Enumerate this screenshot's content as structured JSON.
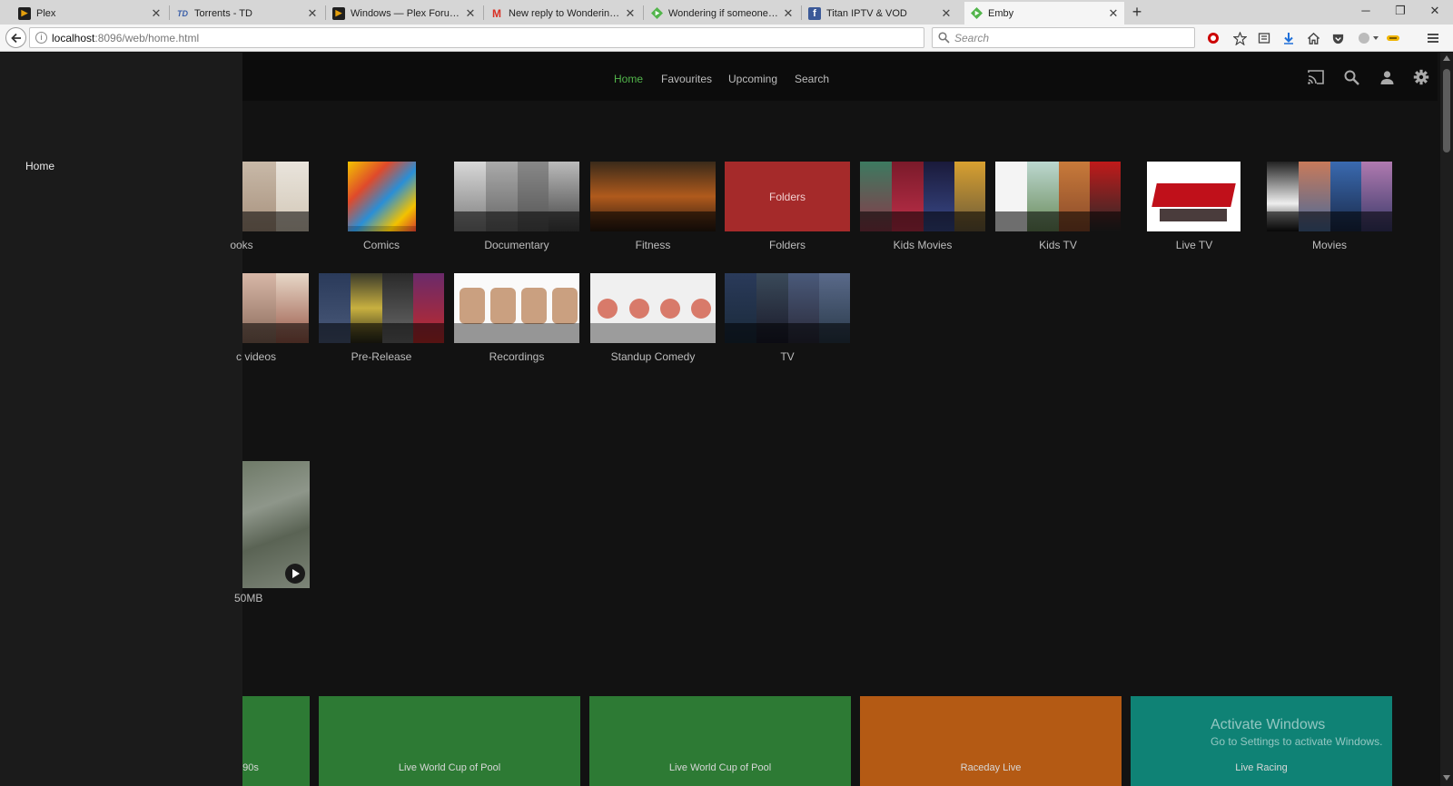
{
  "browser": {
    "tabs": [
      {
        "label": "Plex",
        "favicon": "plex-icon",
        "active": false
      },
      {
        "label": "Torrents - TD",
        "favicon": "td-icon",
        "active": false
      },
      {
        "label": "Windows — Plex Forums",
        "favicon": "plex-icon",
        "active": false
      },
      {
        "label": "New reply to Wondering if s",
        "favicon": "gmail-icon",
        "active": false
      },
      {
        "label": "Wondering if someone can",
        "favicon": "emby-icon",
        "active": false
      },
      {
        "label": "Titan IPTV & VOD",
        "favicon": "facebook-icon",
        "active": false
      },
      {
        "label": "Emby",
        "favicon": "emby-icon",
        "active": true
      }
    ],
    "url_host": "localhost",
    "url_rest": ":8096/web/home.html",
    "search_placeholder": "Search"
  },
  "drawer": {
    "items": [
      {
        "label": "Home"
      }
    ]
  },
  "header": {
    "nav": [
      {
        "label": "Home",
        "active": true
      },
      {
        "label": "Favourites",
        "active": false
      },
      {
        "label": "Upcoming",
        "active": false
      },
      {
        "label": "Search",
        "active": false
      }
    ]
  },
  "libraries": {
    "row1": [
      {
        "label": "ooks"
      },
      {
        "label": "Comics"
      },
      {
        "label": "Documentary"
      },
      {
        "label": "Fitness"
      },
      {
        "label": "Folders",
        "tile_text": "Folders"
      },
      {
        "label": "Kids Movies"
      },
      {
        "label": "Kids TV"
      },
      {
        "label": "Live TV"
      },
      {
        "label": "Movies"
      }
    ],
    "row2": [
      {
        "label": "c videos"
      },
      {
        "label": "Pre-Release"
      },
      {
        "label": "Recordings"
      },
      {
        "label": "Standup Comedy"
      },
      {
        "label": "TV"
      }
    ]
  },
  "latest": {
    "item_caption": "50MB"
  },
  "live": {
    "tiles": [
      {
        "label": "90s",
        "color": "#2d7a34"
      },
      {
        "label": "Live World Cup of Pool",
        "color": "#2d7a34"
      },
      {
        "label": "Live World Cup of Pool",
        "color": "#2d7a34"
      },
      {
        "label": "Raceday Live",
        "color": "#b45a14"
      },
      {
        "label": "Live Racing",
        "color": "#0f8275"
      }
    ]
  },
  "watermark": {
    "title": "Activate Windows",
    "subtitle": "Go to Settings to activate Windows."
  },
  "colors": {
    "accent": "#52b54b",
    "folders_tile": "#a52a2a"
  }
}
